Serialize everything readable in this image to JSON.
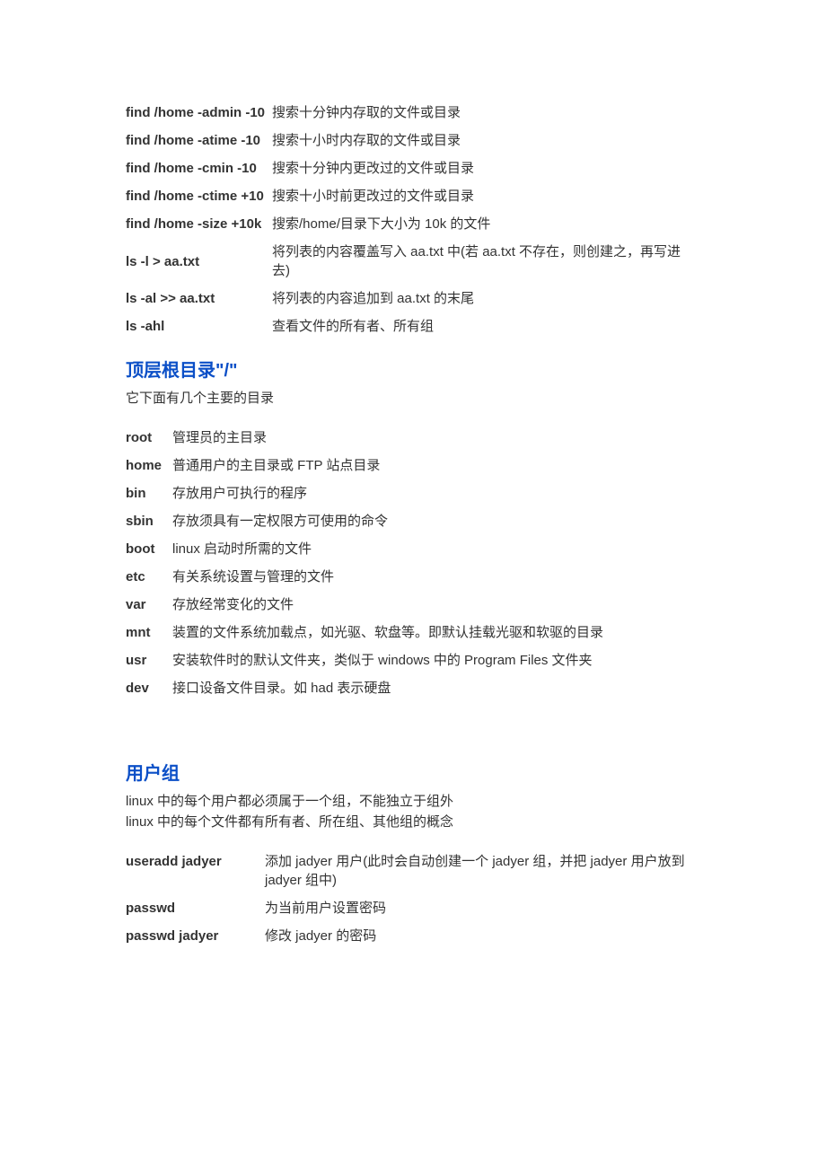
{
  "table1": {
    "rows": [
      {
        "cmd": "find /home -admin -10",
        "desc": "搜索十分钟内存取的文件或目录"
      },
      {
        "cmd": "find /home -atime -10",
        "desc": "搜索十小时内存取的文件或目录"
      },
      {
        "cmd": "find /home -cmin -10",
        "desc": "搜索十分钟内更改过的文件或目录"
      },
      {
        "cmd": "find /home -ctime +10",
        "desc": "搜索十小时前更改过的文件或目录"
      },
      {
        "cmd": "find /home -size +10k",
        "desc": "搜索/home/目录下大小为 10k 的文件"
      },
      {
        "cmd": "ls -l > aa.txt",
        "desc": "将列表的内容覆盖写入 aa.txt 中(若 aa.txt 不存在，则创建之，再写进去)"
      },
      {
        "cmd": "ls -al >> aa.txt",
        "desc": "将列表的内容追加到 aa.txt 的末尾"
      },
      {
        "cmd": "ls -ahl",
        "desc": "查看文件的所有者、所有组"
      }
    ]
  },
  "section_root": {
    "title": "顶层根目录\"/\"",
    "subtitle": "它下面有几个主要的目录",
    "rows": [
      {
        "cmd": "root",
        "desc": "管理员的主目录"
      },
      {
        "cmd": "home",
        "desc": "普通用户的主目录或 FTP 站点目录"
      },
      {
        "cmd": "bin",
        "desc": "存放用户可执行的程序"
      },
      {
        "cmd": "sbin",
        "desc": "存放须具有一定权限方可使用的命令"
      },
      {
        "cmd": "boot",
        "desc": "linux 启动时所需的文件"
      },
      {
        "cmd": "etc",
        "desc": "有关系统设置与管理的文件"
      },
      {
        "cmd": "var",
        "desc": "存放经常变化的文件"
      },
      {
        "cmd": "mnt",
        "desc": "装置的文件系统加载点，如光驱、软盘等。即默认挂载光驱和软驱的目录"
      },
      {
        "cmd": "usr",
        "desc": "安装软件时的默认文件夹，类似于 windows 中的 Program Files 文件夹"
      },
      {
        "cmd": "dev",
        "desc": "接口设备文件目录。如 had 表示硬盘"
      }
    ]
  },
  "section_group": {
    "title": "用户组",
    "subtitle1": "linux 中的每个用户都必须属于一个组，不能独立于组外",
    "subtitle2": "linux 中的每个文件都有所有者、所在组、其他组的概念",
    "rows": [
      {
        "cmd": "useradd jadyer",
        "desc": "添加 jadyer 用户(此时会自动创建一个 jadyer 组，并把 jadyer 用户放到 jadyer 组中)"
      },
      {
        "cmd": "passwd",
        "desc": "为当前用户设置密码"
      },
      {
        "cmd": "passwd jadyer",
        "desc": "修改 jadyer 的密码"
      }
    ]
  }
}
